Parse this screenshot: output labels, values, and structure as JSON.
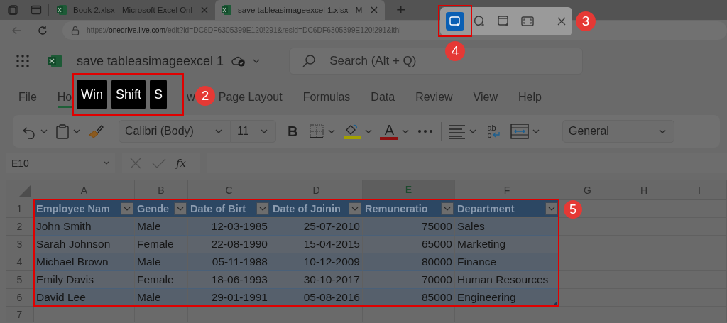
{
  "browser": {
    "tabs": [
      {
        "title": "Book 2.xlsx - Microsoft Excel Onl",
        "selected": false
      },
      {
        "title": "save tableasimageexcel 1.xlsx - M",
        "selected": true
      }
    ],
    "new_tab": "+",
    "url": "https://**onedrive.live.com**/edit?id=DC6DF6305399E120!291&resid=DC6DF6305399E120!291&ithi"
  },
  "app": {
    "title": "save tableasimageexcel 1",
    "search": {
      "placeholder": "Search (Alt + Q)"
    }
  },
  "ribbon_tabs": [
    {
      "label": "File",
      "selected": false
    },
    {
      "label": "Ho",
      "selected": true
    },
    {
      "label": "w",
      "selected": false
    },
    {
      "label": "Page Layout",
      "selected": false
    },
    {
      "label": "Formulas",
      "selected": false
    },
    {
      "label": "Data",
      "selected": false
    },
    {
      "label": "Review",
      "selected": false
    },
    {
      "label": "View",
      "selected": false
    },
    {
      "label": "Help",
      "selected": false
    }
  ],
  "toolbar": {
    "font": "Calibri (Body)",
    "size": "11",
    "bold": "B",
    "font_color": "A",
    "wrap_text": [
      "ab",
      "c"
    ],
    "number_format": "General"
  },
  "formula_bar": {
    "name_box": "E10",
    "function": "fx"
  },
  "sheet": {
    "columns": [
      {
        "label": "A",
        "selected": false
      },
      {
        "label": "B",
        "selected": false
      },
      {
        "label": "C",
        "selected": false
      },
      {
        "label": "D",
        "selected": false
      },
      {
        "label": "E",
        "selected": true
      },
      {
        "label": "F",
        "selected": false
      },
      {
        "label": "G",
        "selected": false
      },
      {
        "label": "H",
        "selected": false
      },
      {
        "label": "I",
        "selected": false
      }
    ],
    "rows": [
      "1",
      "2",
      "3",
      "4",
      "5",
      "6",
      "7"
    ],
    "table": {
      "headers": [
        "Employee Nam",
        "Gende",
        "Date of Birt",
        "Date of Joinin",
        "Remuneratio",
        "Department"
      ],
      "rows": [
        [
          "John Smith",
          "Male",
          "12-03-1985",
          "25-07-2010",
          "75000",
          "Sales"
        ],
        [
          "Sarah Johnson",
          "Female",
          "22-08-1990",
          "15-04-2015",
          "65000",
          "Marketing"
        ],
        [
          "Michael Brown",
          "Male",
          "05-11-1988",
          "10-12-2009",
          "80000",
          "Finance"
        ],
        [
          "Emily Davis",
          "Female",
          "18-06-1993",
          "30-10-2017",
          "70000",
          "Human Resources"
        ],
        [
          "David Lee",
          "Male",
          "29-01-1991",
          "05-08-2016",
          "85000",
          "Engineering"
        ]
      ]
    },
    "badge": "5"
  },
  "snip_toolbar": {
    "modes": [
      {
        "kind": "rectangle",
        "selected": true
      },
      {
        "kind": "freeform",
        "selected": false
      },
      {
        "kind": "window",
        "selected": false
      },
      {
        "kind": "fullscreen",
        "selected": false
      }
    ],
    "badge": "3",
    "mode_badge": "4"
  },
  "shortcut_callout": {
    "keys": [
      "Win",
      "Shift",
      "S"
    ],
    "badge": "2"
  }
}
